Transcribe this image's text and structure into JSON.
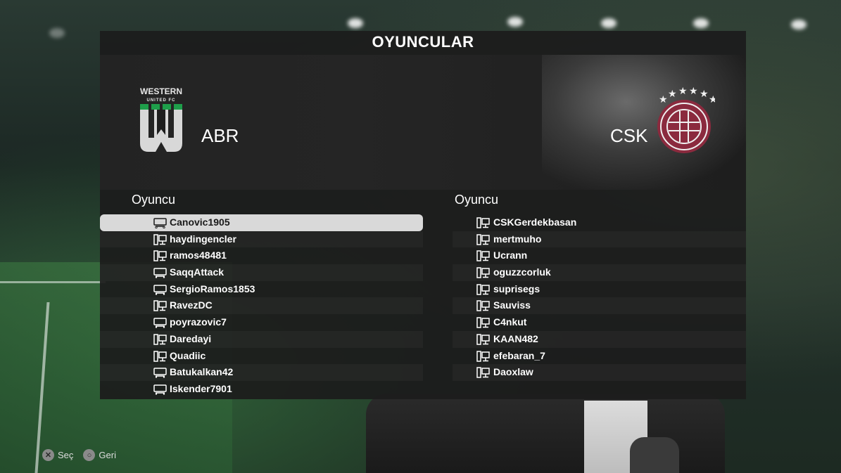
{
  "title": "OYUNCULAR",
  "home_team": {
    "name": "ABR",
    "crest_text": "WESTERN",
    "crest_subtext": "UNITED FC"
  },
  "away_team": {
    "name": "CSK"
  },
  "column_header": "Oyuncu",
  "home_players": [
    {
      "name": "Canovic1905",
      "platform": "console-icon",
      "selected": true
    },
    {
      "name": "haydingencler",
      "platform": "pc-icon"
    },
    {
      "name": "ramos48481",
      "platform": "pc-icon"
    },
    {
      "name": "SaqqAttack",
      "platform": "console-icon"
    },
    {
      "name": "SergioRamos1853",
      "platform": "console-icon"
    },
    {
      "name": "RavezDC",
      "platform": "pc-icon"
    },
    {
      "name": "poyrazovic7",
      "platform": "console-icon"
    },
    {
      "name": "Daredayi",
      "platform": "pc-icon"
    },
    {
      "name": "Quadiic",
      "platform": "pc-icon"
    },
    {
      "name": "Batukalkan42",
      "platform": "console-icon"
    },
    {
      "name": "Iskender7901",
      "platform": "console-icon"
    }
  ],
  "away_players": [
    {
      "name": "CSKGerdekbasan",
      "platform": "pc-icon"
    },
    {
      "name": "mertmuho",
      "platform": "pc-icon"
    },
    {
      "name": "Ucrann",
      "platform": "pc-icon"
    },
    {
      "name": "oguzzcorluk",
      "platform": "pc-icon"
    },
    {
      "name": "suprisegs",
      "platform": "pc-icon"
    },
    {
      "name": "Sauviss",
      "platform": "pc-icon"
    },
    {
      "name": "C4nkut",
      "platform": "pc-icon"
    },
    {
      "name": "KAAN482",
      "platform": "pc-icon"
    },
    {
      "name": "efebaran_7",
      "platform": "pc-icon"
    },
    {
      "name": "Daoxlaw",
      "platform": "pc-icon"
    }
  ],
  "footer": {
    "select_label": "Seç",
    "select_icon": "cross-button-icon",
    "back_label": "Geri",
    "back_icon": "circle-button-icon"
  },
  "colors": {
    "panel": "#1c1c1c",
    "selected_row": "#d9d9d9",
    "away_crest": "#8b2a3e",
    "home_crest_accent": "#1e9e4a"
  }
}
